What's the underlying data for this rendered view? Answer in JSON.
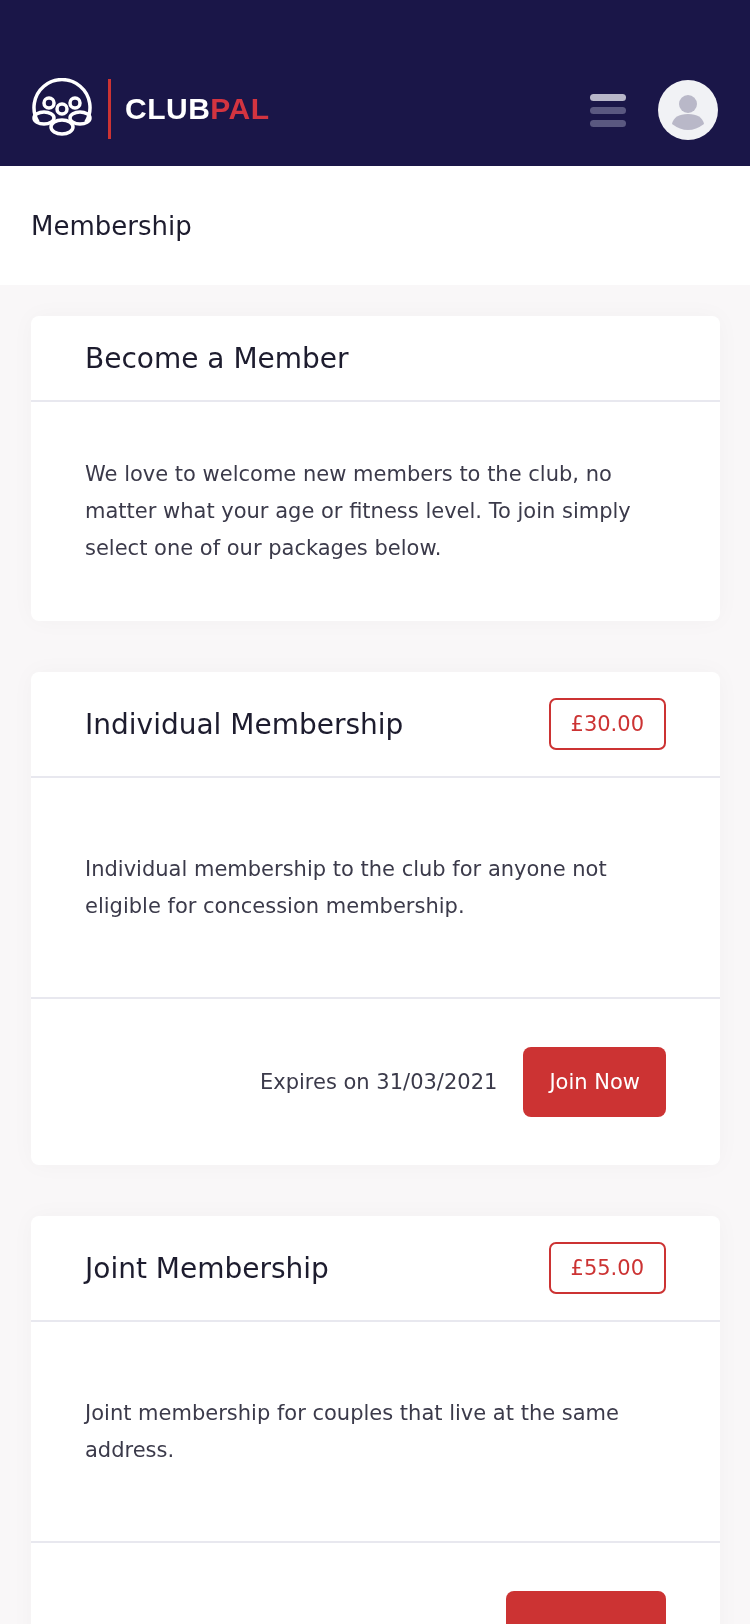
{
  "header": {
    "logo": {
      "part_1": "CLUB",
      "part_2": "PAL"
    }
  },
  "page_title": "Membership",
  "cards": [
    {
      "title": "Become a Member",
      "description": "We love to welcome new members to the club, no matter what your age or fitness level. To join simply select one of our packages below."
    },
    {
      "title": "Individual Membership",
      "price": "£30.00",
      "description": "Individual membership to the club for anyone not eligible for concession membership.",
      "expiry": "Expires on 31/03/2021",
      "button": "Join Now"
    },
    {
      "title": "Joint Membership",
      "price": "£55.00",
      "description": "Joint membership for couples that live at the same address.",
      "footer_cut_off": true
    }
  ]
}
